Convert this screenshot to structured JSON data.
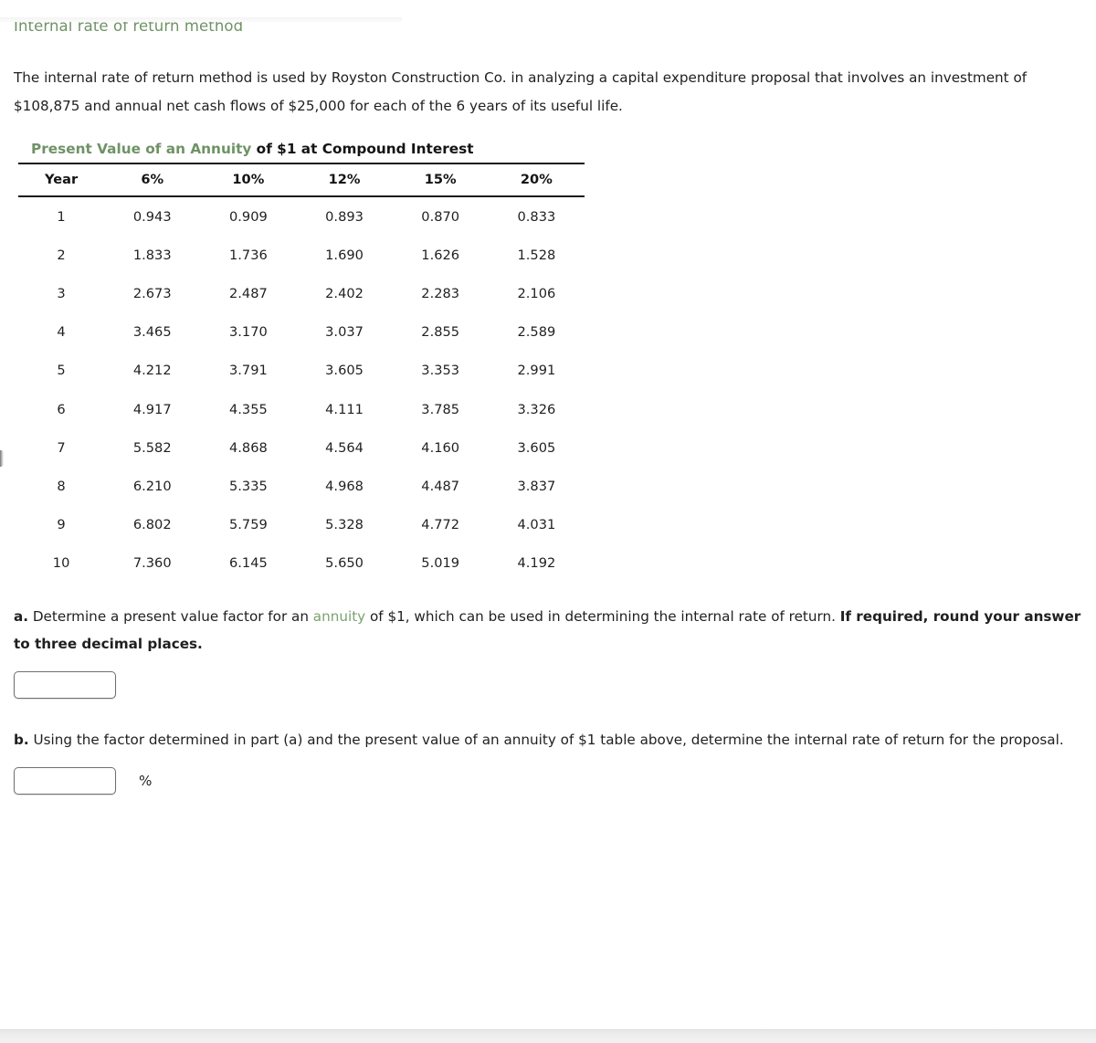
{
  "page": {
    "title": "Internal rate of return method",
    "intro": "The internal rate of return method is used by Royston Construction Co. in analyzing a capital expenditure proposal that involves an investment of $108,875 and annual net cash flows of $25,000 for each of the 6 years of its useful life."
  },
  "table": {
    "caption_green": "Present Value of an Annuity",
    "caption_black": " of $1 at Compound Interest",
    "columns": [
      "Year",
      "6%",
      "10%",
      "12%",
      "15%",
      "20%"
    ],
    "rows": [
      [
        "1",
        "0.943",
        "0.909",
        "0.893",
        "0.870",
        "0.833"
      ],
      [
        "2",
        "1.833",
        "1.736",
        "1.690",
        "1.626",
        "1.528"
      ],
      [
        "3",
        "2.673",
        "2.487",
        "2.402",
        "2.283",
        "2.106"
      ],
      [
        "4",
        "3.465",
        "3.170",
        "3.037",
        "2.855",
        "2.589"
      ],
      [
        "5",
        "4.212",
        "3.791",
        "3.605",
        "3.353",
        "2.991"
      ],
      [
        "6",
        "4.917",
        "4.355",
        "4.111",
        "3.785",
        "3.326"
      ],
      [
        "7",
        "5.582",
        "4.868",
        "4.564",
        "4.160",
        "3.605"
      ],
      [
        "8",
        "6.210",
        "5.335",
        "4.968",
        "4.487",
        "3.837"
      ],
      [
        "9",
        "6.802",
        "5.759",
        "5.328",
        "4.772",
        "4.031"
      ],
      [
        "10",
        "7.360",
        "6.145",
        "5.650",
        "5.019",
        "4.192"
      ]
    ]
  },
  "question_a": {
    "label": "a.",
    "text_1": " Determine a present value factor for an ",
    "link": "annuity",
    "text_2": " of $1, which can be used in determining the internal rate of return. ",
    "bold_tail": "If required, round your answer to three decimal places.",
    "input_value": "",
    "input_placeholder": ""
  },
  "question_b": {
    "label": "b.",
    "text": " Using the factor determined in part (a) and the present value of an annuity of $1 table above, determine the internal rate of return for the proposal.",
    "input_value": "",
    "input_placeholder": "",
    "unit": "%"
  },
  "colors": {
    "accent_green": "#6f9266",
    "link_green": "#7aa26f",
    "text": "#1f1f1f",
    "rule": "#1a1a1a"
  }
}
